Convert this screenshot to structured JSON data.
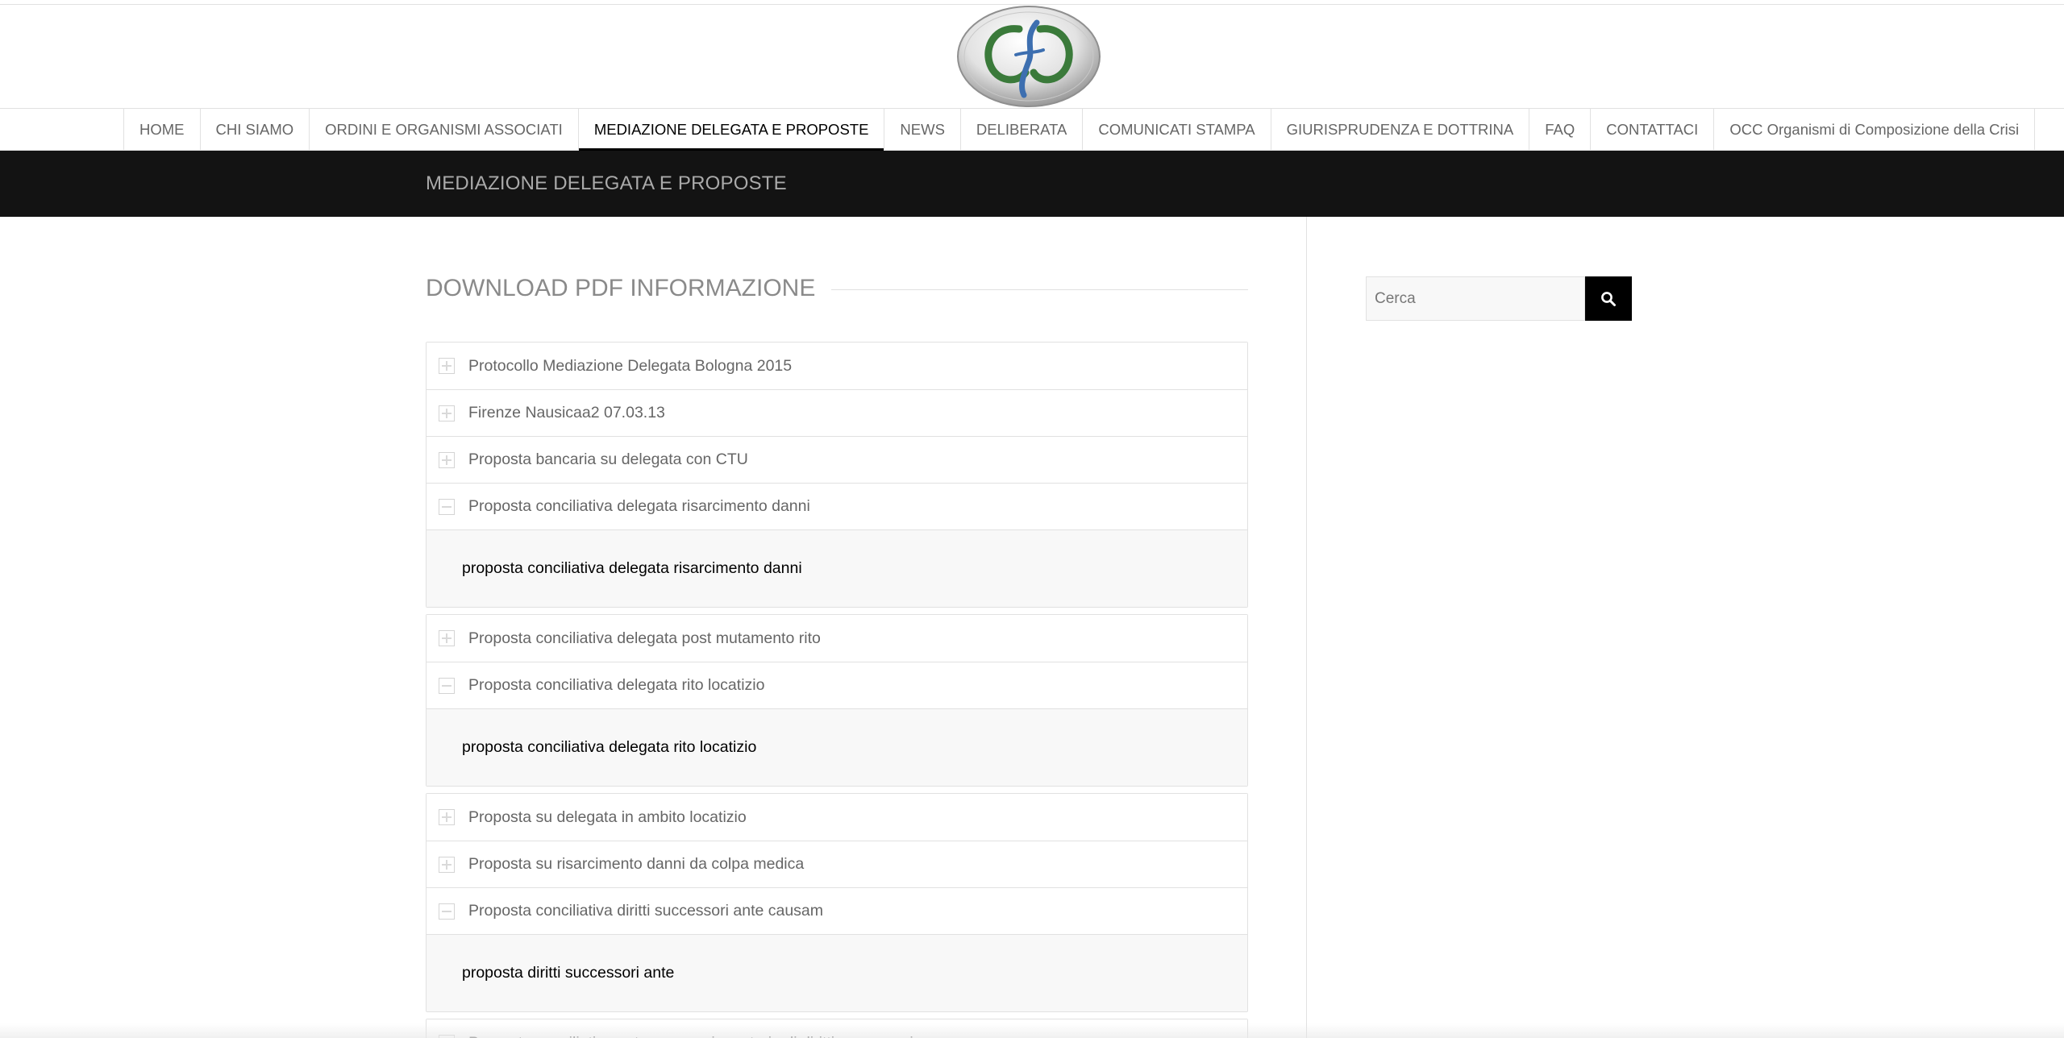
{
  "site": {
    "logo_alt": "logo-icon"
  },
  "nav": {
    "items": [
      {
        "label": "HOME",
        "active": false
      },
      {
        "label": "CHI SIAMO",
        "active": false
      },
      {
        "label": "ORDINI E ORGANISMI ASSOCIATI",
        "active": false
      },
      {
        "label": "MEDIAZIONE DELEGATA E PROPOSTE",
        "active": true
      },
      {
        "label": "NEWS",
        "active": false
      },
      {
        "label": "DELIBERATA",
        "active": false
      },
      {
        "label": "COMUNICATI STAMPA",
        "active": false
      },
      {
        "label": "GIURISPRUDENZA E DOTTRINA",
        "active": false
      },
      {
        "label": "FAQ",
        "active": false
      },
      {
        "label": "CONTATTACI",
        "active": false
      },
      {
        "label": "OCC Organismi di Composizione della Crisi",
        "active": false
      }
    ]
  },
  "page": {
    "title": "MEDIAZIONE DELEGATA E PROPOSTE",
    "section_heading": "DOWNLOAD PDF INFORMAZIONE"
  },
  "accordion": {
    "groups": [
      {
        "toggles": [
          {
            "label": "Protocollo Mediazione Delegata Bologna 2015",
            "open": false
          },
          {
            "label": "Firenze Nausicaa2 07.03.13",
            "open": false
          },
          {
            "label": "Proposta bancaria su delegata con CTU",
            "open": false
          },
          {
            "label": "Proposta conciliativa delegata risarcimento danni",
            "open": true
          }
        ],
        "panel": "proposta conciliativa delegata risarcimento danni"
      },
      {
        "toggles": [
          {
            "label": "Proposta conciliativa delegata post mutamento rito",
            "open": false
          },
          {
            "label": "Proposta conciliativa delegata rito locatizio",
            "open": true
          }
        ],
        "panel": "proposta conciliativa delegata rito locatizio"
      },
      {
        "toggles": [
          {
            "label": "Proposta su delegata in ambito locatizio",
            "open": false
          },
          {
            "label": "Proposta su risarcimento danni da colpa medica",
            "open": false
          },
          {
            "label": "Proposta conciliativa diritti successori ante causam",
            "open": true
          }
        ],
        "panel": "proposta diritti successori ante"
      },
      {
        "toggles": [
          {
            "label": "Proposta conciliativa ante causam in materia di diritti successori",
            "open": false
          }
        ],
        "panel": null
      }
    ]
  },
  "search": {
    "placeholder": "Cerca",
    "value": ""
  },
  "colors": {
    "titlebar_bg": "#131313",
    "accent": "#000000",
    "logo_green": "#3a7a3a",
    "logo_blue": "#3d6fb0"
  }
}
